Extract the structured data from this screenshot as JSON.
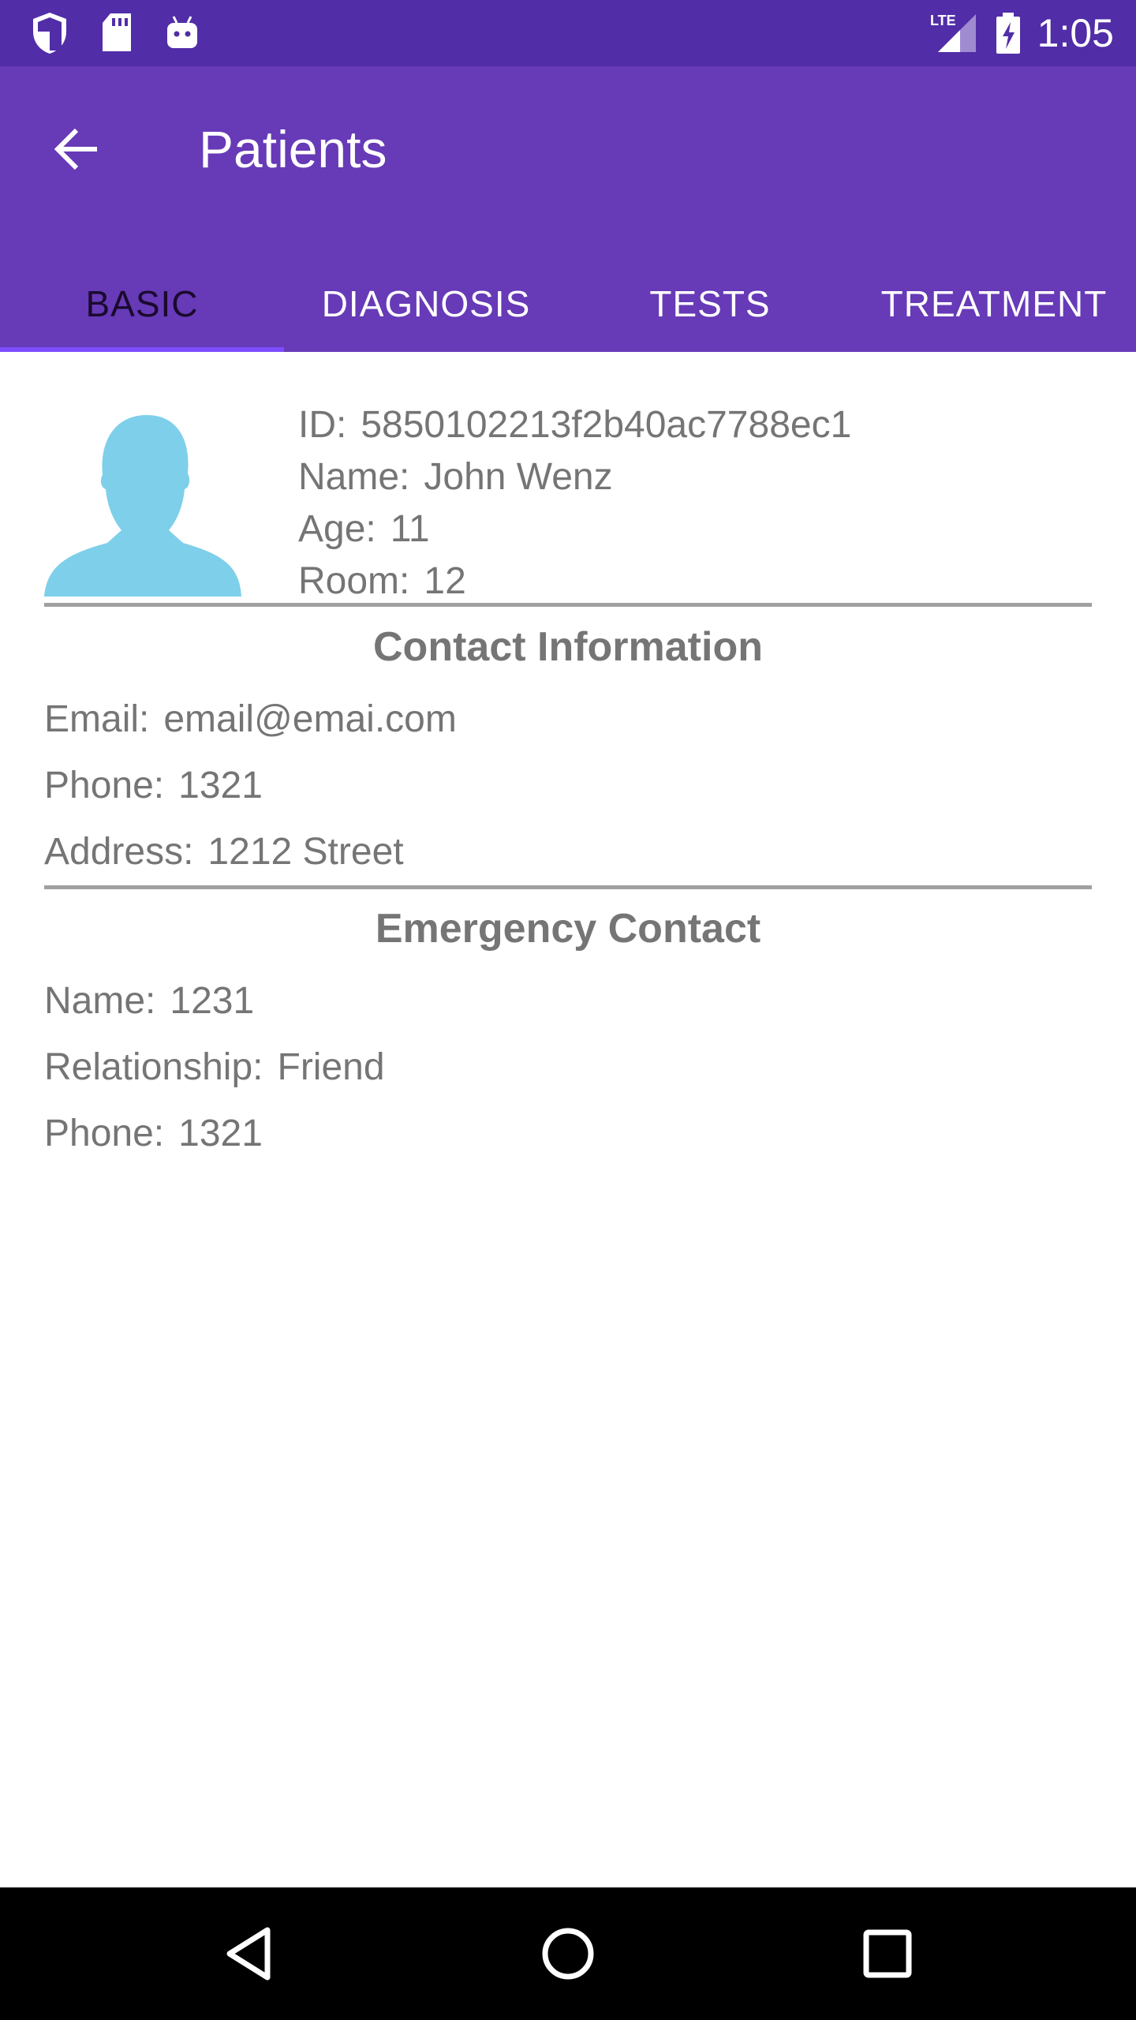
{
  "status_bar": {
    "time": "1:05",
    "network": "LTE",
    "icons": [
      "shield-icon",
      "sd-card-icon",
      "android-icon",
      "signal-icon",
      "battery-charging-icon"
    ]
  },
  "app_bar": {
    "title": "Patients",
    "back_icon": "arrow-back-icon"
  },
  "tabs": [
    {
      "label": "BASIC",
      "active": true
    },
    {
      "label": "DIAGNOSIS",
      "active": false
    },
    {
      "label": "TESTS",
      "active": false
    },
    {
      "label": "TREATMENT",
      "active": false
    }
  ],
  "patient": {
    "id_label": "ID:",
    "id": "5850102213f2b40ac7788ec1",
    "name_label": "Name:",
    "name": "John Wenz",
    "age_label": "Age:",
    "age": "11",
    "room_label": "Room:",
    "room": "12"
  },
  "contact": {
    "title": "Contact Information",
    "email_label": "Email:",
    "email": "email@emai.com",
    "phone_label": "Phone:",
    "phone": "1321",
    "address_label": "Address:",
    "address": "1212 Street"
  },
  "emergency": {
    "title": "Emergency Contact",
    "name_label": "Name:",
    "name": "1231",
    "relationship_label": "Relationship:",
    "relationship": "Friend",
    "phone_label": "Phone:",
    "phone": "1321"
  },
  "nav_bar": {
    "icons": [
      "back-triangle-icon",
      "home-circle-icon",
      "recents-square-icon"
    ]
  },
  "colors": {
    "status_bar": "#512da8",
    "app_bar": "#673ab7",
    "tab_indicator": "#7c4dff",
    "avatar": "#7ecfea",
    "text_secondary": "#757575"
  }
}
